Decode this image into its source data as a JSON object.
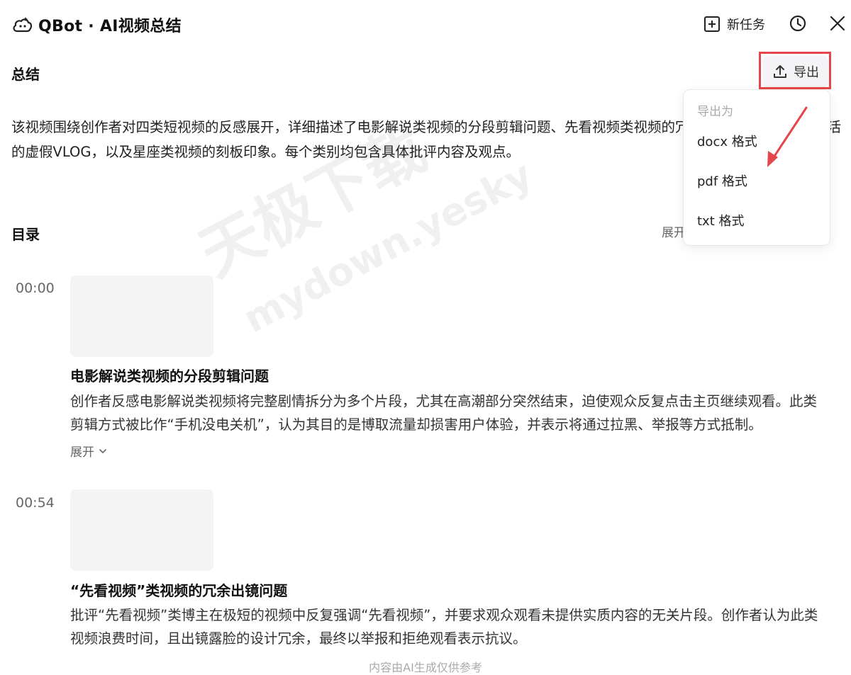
{
  "header": {
    "brand_name": "QBot · AI视频总结",
    "new_task_label": "新任务",
    "icons": {
      "logo": "cloud-bot-icon",
      "new_task": "plus-square-icon",
      "history": "clock-icon",
      "close": "close-icon"
    }
  },
  "summary": {
    "title": "总结",
    "export_label": "导出",
    "text": "该视频围绕创作者对四类短视频的反感展开，详细描述了电影解说类视频的分段剪辑问题、先看视频类视频的冗余出镜、假装高质量生活的虚假VLOG，以及星座类视频的刻板印象。每个类别均包含具体批评内容及观点。"
  },
  "export_menu": {
    "header": "导出为",
    "options": [
      "docx 格式",
      "pdf 格式",
      "txt 格式"
    ]
  },
  "toc": {
    "title": "目录",
    "expand_label": "展开",
    "items": [
      {
        "time": "00:00",
        "title": "电影解说类视频的分段剪辑问题",
        "text": "创作者反感电影解说类视频将完整剧情拆分为多个片段，尤其在高潮部分突然结束，迫使观众反复点击主页继续观看。此类剪辑方式被比作“手机没电关机”，认为其目的是博取流量却损害用户体验，并表示将通过拉黑、举报等方式抵制。",
        "expand_label": "展开"
      },
      {
        "time": "00:54",
        "title": "“先看视频”类视频的冗余出镜问题",
        "text": "批评“先看视频”类博主在极短的视频中反复强调“先看视频”，并要求观众观看未提供实质内容的无关片段。创作者认为此类视频浪费时间，且出镜露脸的设计冗余，最终以举报和拒绝观看表示抗议。"
      }
    ]
  },
  "footer": {
    "note": "内容由AI生成仅供参考"
  },
  "watermark": {
    "line1": "天极下载",
    "line2": "mydown.yesky.com"
  },
  "colors": {
    "highlight_box": "#e5464b",
    "arrow": "#e5464b",
    "thumbnail": "#f4f4f4"
  }
}
